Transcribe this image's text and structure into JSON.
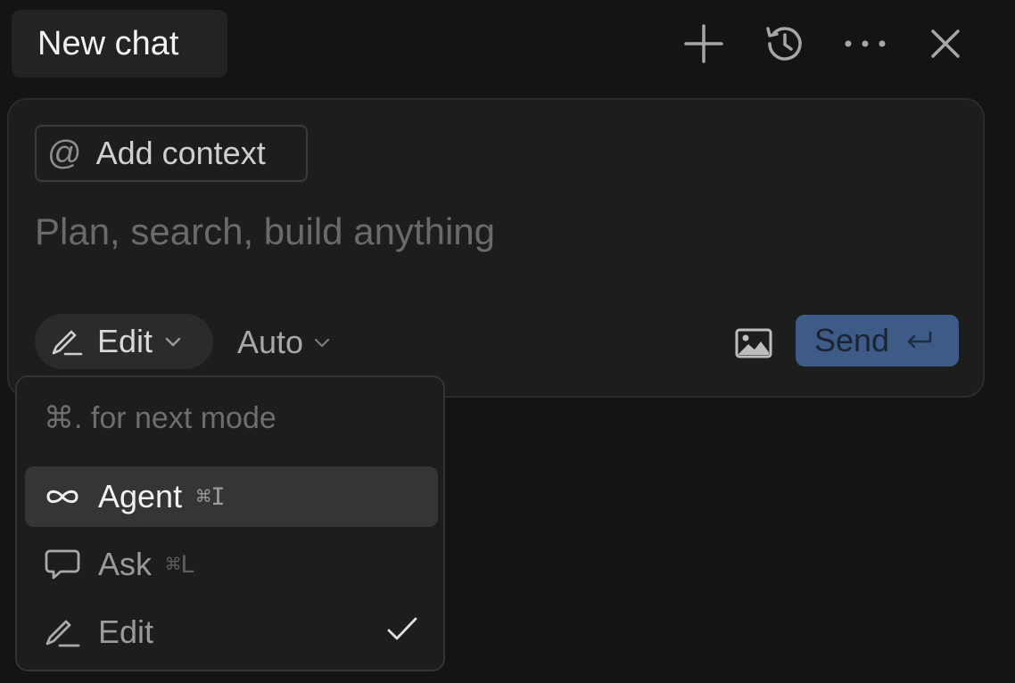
{
  "header": {
    "title": "New chat",
    "actions": [
      {
        "icon": "plus-icon"
      },
      {
        "icon": "history-icon"
      },
      {
        "icon": "more-icon"
      },
      {
        "icon": "close-icon"
      }
    ]
  },
  "composer": {
    "context_label": "Add context",
    "context_icon": "@",
    "placeholder": "Plan, search, build anything",
    "value": "",
    "mode_label": "Edit",
    "model_label": "Auto",
    "send_label": "Send"
  },
  "mode_menu": {
    "hint": "⌘. for next mode",
    "items": [
      {
        "label": "Agent",
        "shortcut": "⌘I",
        "icon": "infinity-icon"
      },
      {
        "label": "Ask",
        "shortcut": "⌘L",
        "icon": "chat-bubble-icon"
      },
      {
        "label": "Edit",
        "shortcut": "",
        "icon": "pencil-icon",
        "selected": true
      }
    ],
    "highlighted": "Agent"
  },
  "colors": {
    "background": "#141414",
    "panel": "#1d1d1d",
    "send_button": "#3e5a86",
    "highlight": "#353535"
  }
}
